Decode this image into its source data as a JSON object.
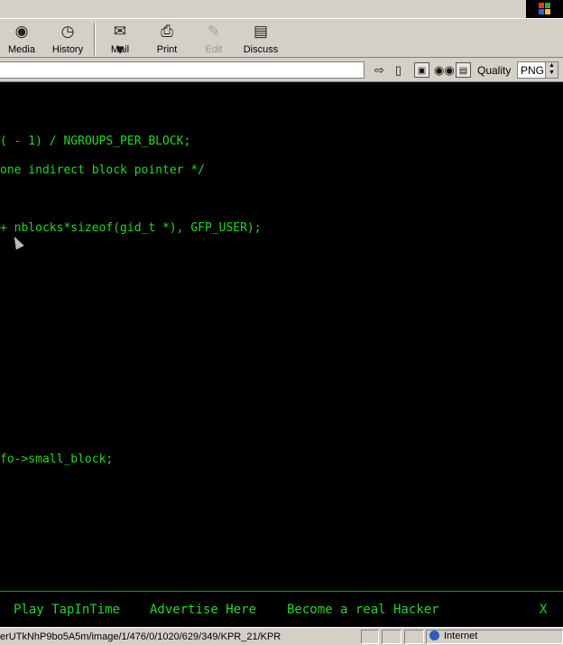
{
  "toolbar": {
    "media": {
      "label": "Media",
      "icon": "media-icon"
    },
    "history": {
      "label": "History",
      "icon": "history-icon"
    },
    "mail": {
      "label": "Mail",
      "icon": "mail-icon"
    },
    "print": {
      "label": "Print",
      "icon": "printer-icon"
    },
    "edit": {
      "label": "Edit",
      "icon": "edit-icon"
    },
    "discuss": {
      "label": "Discuss",
      "icon": "discuss-icon"
    }
  },
  "addressbar": {
    "quality_label": "Quality",
    "quality_value": "PNG"
  },
  "terminal": {
    "lines": [
      "( - 1) / NGROUPS_PER_BLOCK;",
      "one indirect block pointer */",
      "+ nblocks*sizeof(gid_t *), GFP_USER);",
      "fo->small_block;"
    ],
    "text_color": "#22d822",
    "background": "#000000"
  },
  "adbar": {
    "links": [
      "Play TapInTime",
      "Advertise Here",
      "Become a real Hacker"
    ],
    "close": "X"
  },
  "statusbar": {
    "url": "erUTkNhP9bo5A5m/image/1/476/0/1020/629/349/KPR_21/KPR",
    "zone": "Internet"
  }
}
